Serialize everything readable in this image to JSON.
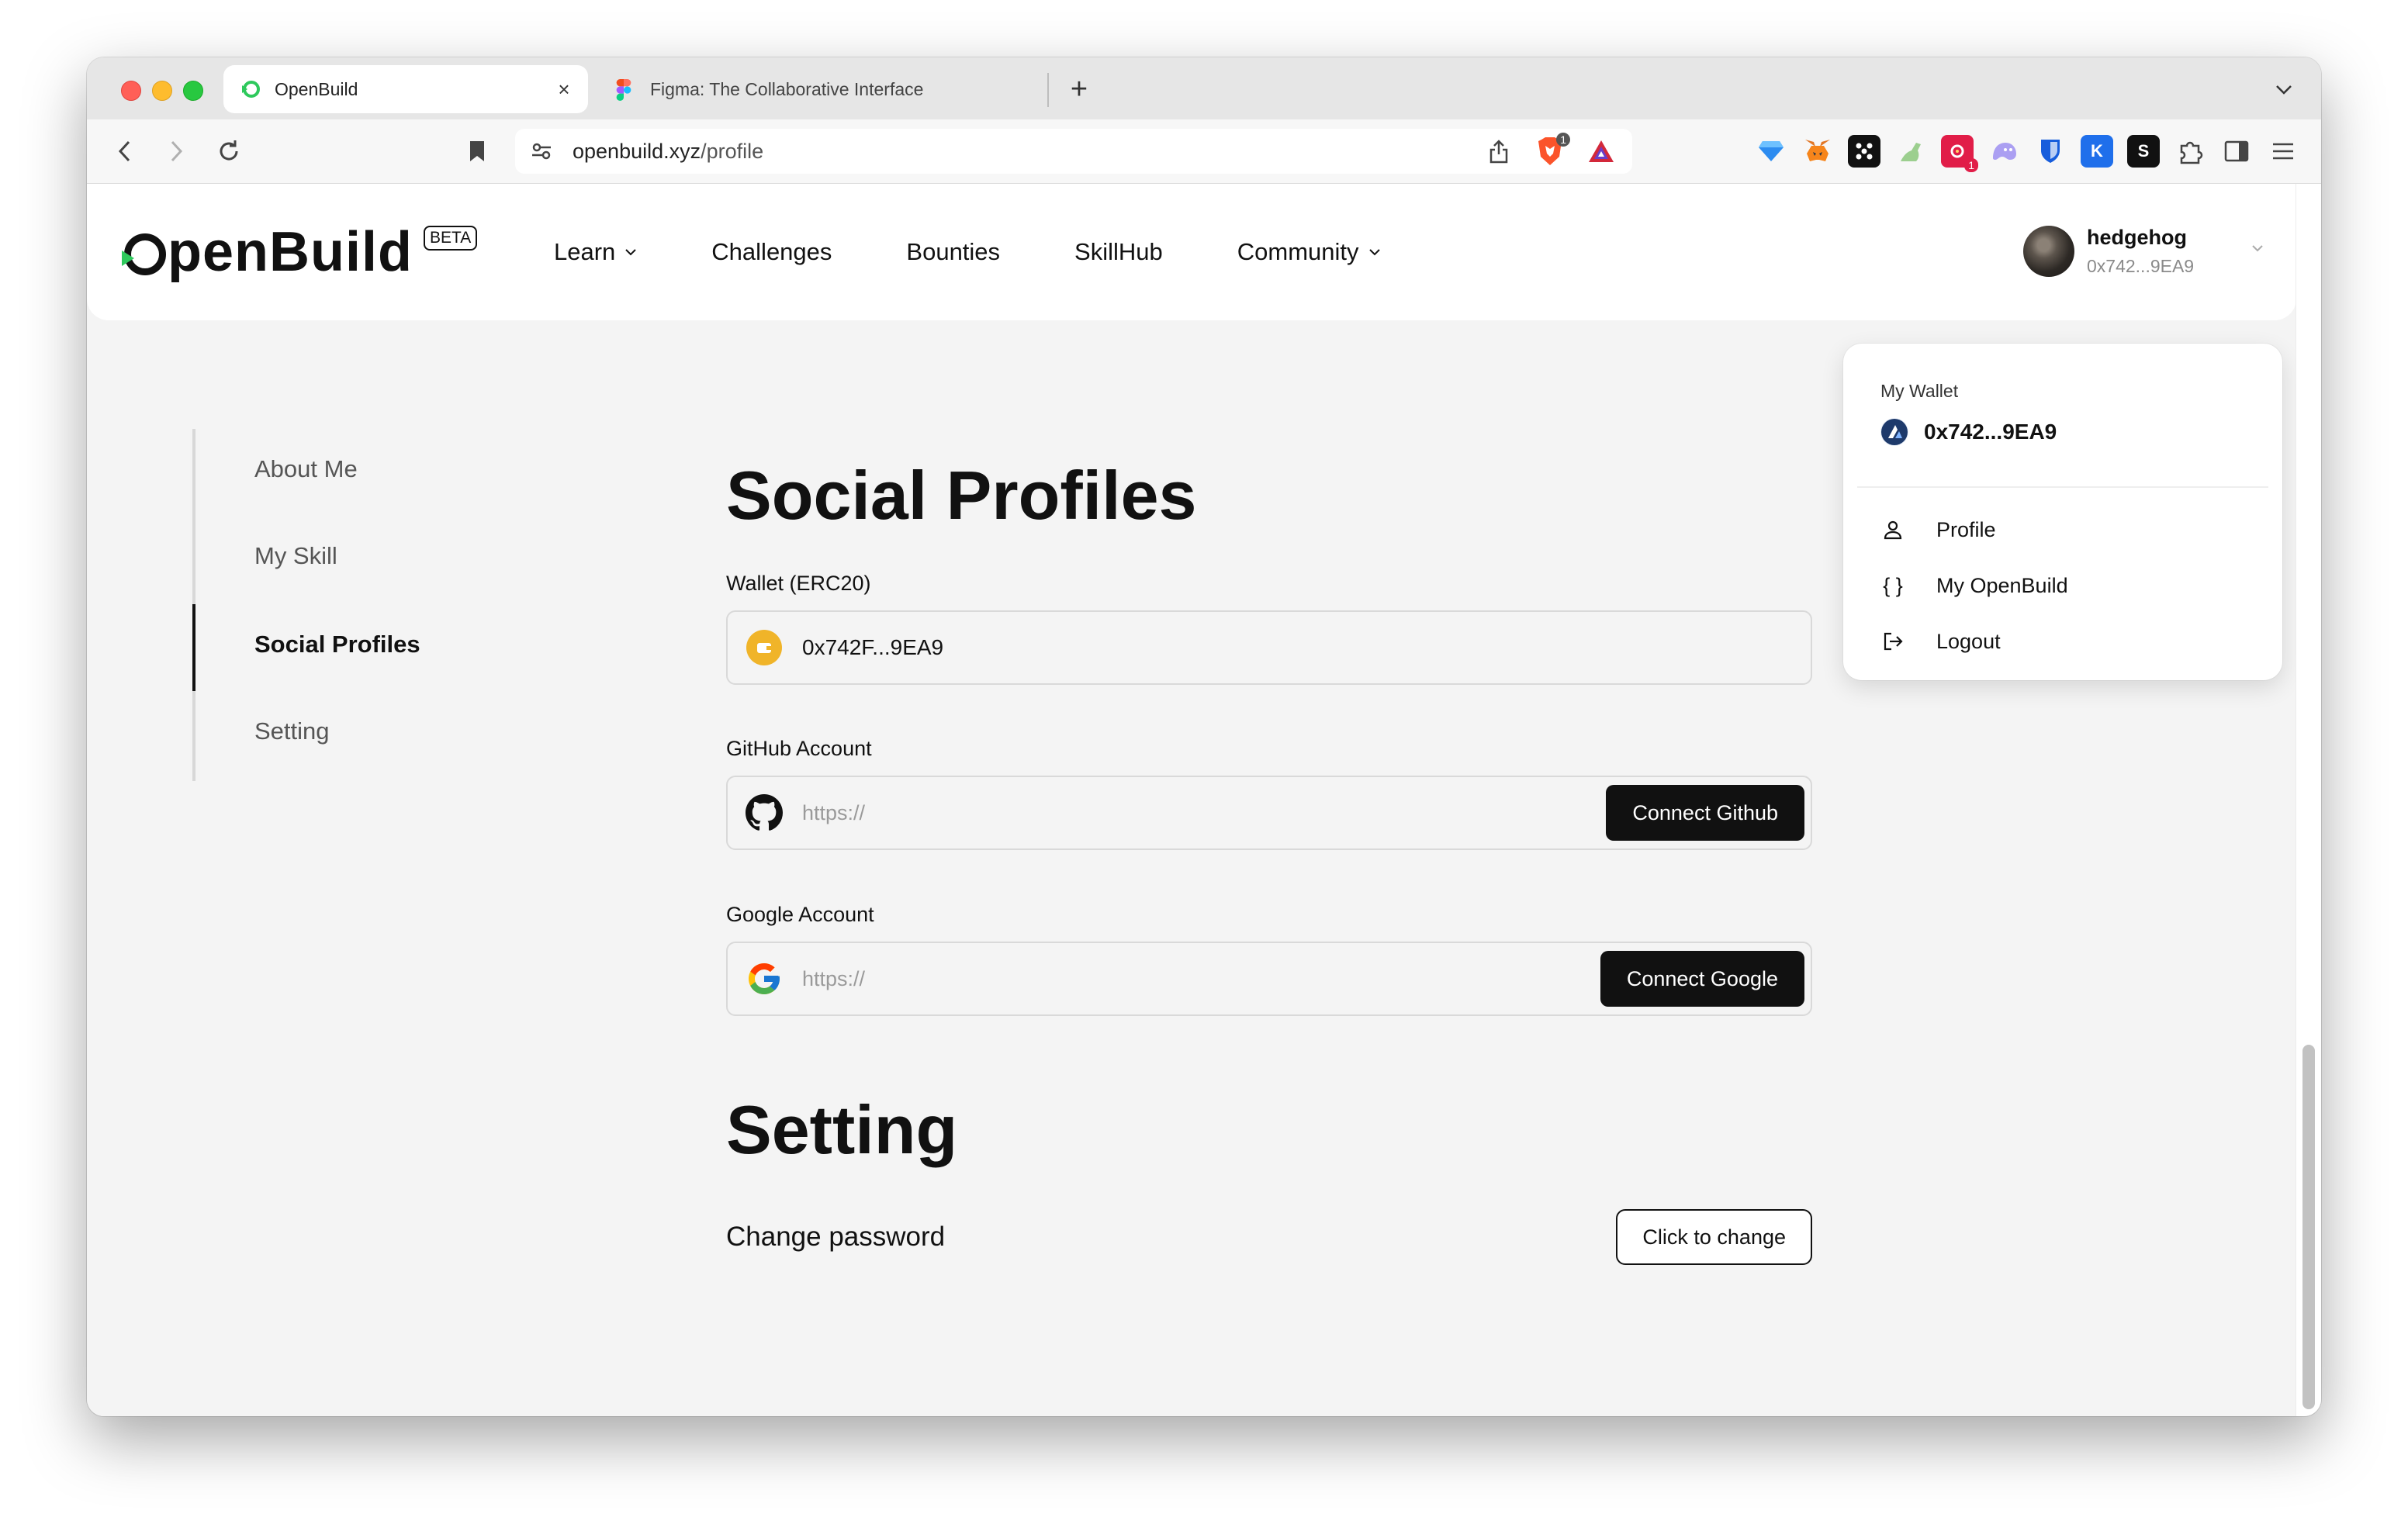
{
  "browser": {
    "tabs": [
      {
        "title": "OpenBuild",
        "active": true
      },
      {
        "title": "Figma: The Collaborative Interface",
        "active": false
      }
    ],
    "url_domain": "openbuild.xyz",
    "url_path": "/profile",
    "shield_count": "1",
    "extension_badge": "1"
  },
  "header": {
    "logo_text": "penBuild",
    "beta_label": "BETA",
    "nav": [
      "Learn",
      "Challenges",
      "Bounties",
      "SkillHub",
      "Community"
    ],
    "user": {
      "name": "hedgehog",
      "address": "0x742...9EA9"
    }
  },
  "sidebar": {
    "items": [
      "About Me",
      "My Skill",
      "Social Profiles",
      "Setting"
    ],
    "active": "Social Profiles"
  },
  "social": {
    "title": "Social Profiles",
    "wallet_label": "Wallet (ERC20)",
    "wallet_value": "0x742F...9EA9",
    "github_label": "GitHub Account",
    "github_placeholder": "https://",
    "github_button": "Connect Github",
    "google_label": "Google Account",
    "google_placeholder": "https://",
    "google_button": "Connect Google"
  },
  "setting": {
    "title": "Setting",
    "change_password_label": "Change password",
    "change_button": "Click to change"
  },
  "dropdown": {
    "wallet_heading": "My Wallet",
    "wallet_address": "0x742...9EA9",
    "items": [
      "Profile",
      "My OpenBuild",
      "Logout"
    ]
  },
  "colors": {
    "brand_green": "#2ec95c",
    "button_dark": "#111111",
    "wallet_gold": "#f0b429"
  }
}
